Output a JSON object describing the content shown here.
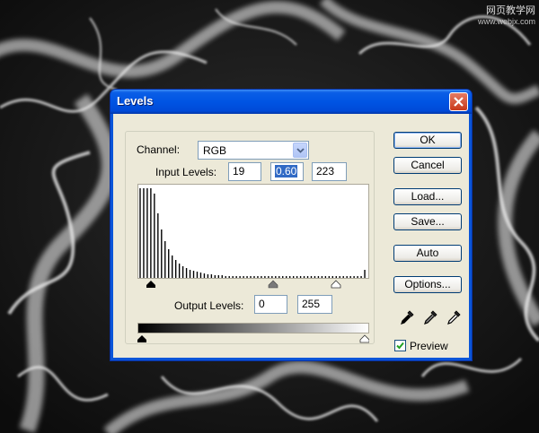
{
  "watermark": {
    "text": "网页教学网",
    "url": "www.webjx.com"
  },
  "window": {
    "title": "Levels"
  },
  "channel": {
    "label": "Channel:",
    "value": "RGB"
  },
  "input_levels": {
    "label": "Input Levels:",
    "black": "19",
    "gamma": "0.60",
    "white": "223"
  },
  "output_levels": {
    "label": "Output Levels:",
    "black": "0",
    "white": "255"
  },
  "histogram": {
    "bars": [
      100,
      100,
      100,
      100,
      94,
      72,
      54,
      41,
      32,
      25,
      20,
      16,
      13,
      11,
      9,
      8,
      7,
      6,
      5,
      4,
      4,
      3,
      3,
      3,
      2,
      2,
      2,
      2,
      2,
      2,
      2,
      2,
      2,
      2,
      2,
      2,
      2,
      2,
      2,
      2,
      2,
      2,
      2,
      2,
      2,
      2,
      2,
      2,
      2,
      2,
      2,
      2,
      2,
      2,
      2,
      2,
      2,
      2,
      2,
      2,
      2,
      2,
      2,
      9
    ]
  },
  "buttons": {
    "ok": "OK",
    "cancel": "Cancel",
    "load": "Load...",
    "save": "Save...",
    "auto": "Auto",
    "options": "Options..."
  },
  "preview": {
    "label": "Preview",
    "checked": true
  },
  "icons": {
    "close": "close-icon",
    "dropdown": "chevron-down-icon",
    "black_eyedropper": "black-eyedropper-icon",
    "gray_eyedropper": "gray-eyedropper-icon",
    "white_eyedropper": "white-eyedropper-icon"
  }
}
